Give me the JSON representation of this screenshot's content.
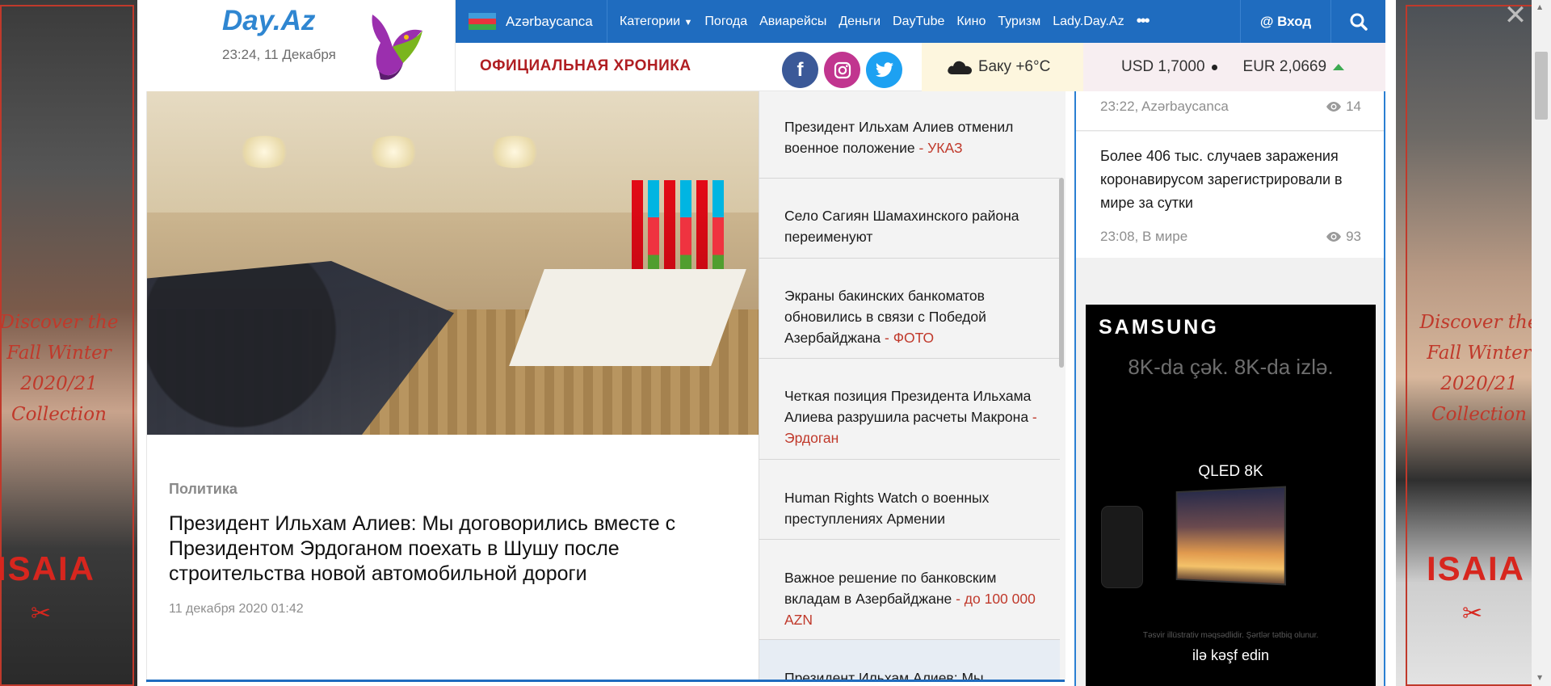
{
  "header": {
    "logo": "Day.Az",
    "datetime": "23:24, 11 Декабря"
  },
  "topbar": {
    "language": "Azərbaycanca",
    "nav": [
      "Категории",
      "Погода",
      "Авиарейсы",
      "Деньги",
      "DayTube",
      "Кино",
      "Туризм",
      "Lady.Day.Az"
    ],
    "more": "•••",
    "login": "@ Вход"
  },
  "subbar": {
    "chronicle": "ОФИЦИАЛЬНАЯ ХРОНИКА",
    "weather": "Баку +6°C",
    "usd": "USD 1,7000",
    "eur": "EUR 2,0669"
  },
  "featured": {
    "category": "Политика",
    "headline": "Президент Ильхам Алиев: Мы договорились вместе с Президентом Эрдоганом поехать в Шушу после строительства новой автомобильной дороги",
    "date": "11 декабря 2020 01:42"
  },
  "news": [
    {
      "text": "Президент Ильхам Алиев отменил военное положение",
      "tag": " - УКАЗ"
    },
    {
      "text": "Село Сагиян Шамахинского района переименуют",
      "tag": ""
    },
    {
      "text": "Экраны бакинских банкоматов обновились в связи с Победой Азербайджана",
      "tag": " - ФОТО"
    },
    {
      "text": "Четкая позиция Президента Ильхама Алиева разрушила расчеты Макрона",
      "tag": " - Эрдоган"
    },
    {
      "text": "Human Rights Watch о военных преступлениях Армении",
      "tag": ""
    },
    {
      "text": "Важное решение по банковским вкладам в Азербайджане",
      "tag": " - до 100 000 AZN"
    },
    {
      "text": "Президент Ильхам Алиев: Мы",
      "tag": ""
    }
  ],
  "right": {
    "item1": {
      "meta": "23:22, Azərbaycanca",
      "views": "14"
    },
    "item2": {
      "title": "Более 406 тыс. случаев заражения коронавирусом зарегистрировали в мире за сутки",
      "meta": "23:08, В мире",
      "views": "93"
    }
  },
  "samsung_ad": {
    "brand": "SAMSUNG",
    "slogan": "8K-da çək. 8K-da izlə.",
    "product": "QLED 8K",
    "fine": "Təsvir illüstrativ məqsədlidir. Şərtlər tətbiq olunur.",
    "cta": "ilə kəşf edin"
  },
  "side_ads": {
    "left_copy": [
      "Discover the",
      "Fall Winter",
      "2020/21",
      "Collection"
    ],
    "left_brand": "ISAIA",
    "right_copy": [
      "Discover the",
      "Fall Winter",
      "2020/21",
      "Collection"
    ],
    "right_brand": "ISAIA"
  },
  "colors": {
    "brand_blue": "#1f6cbf",
    "accent_red": "#b01e22",
    "tag_red": "#c0392b"
  }
}
